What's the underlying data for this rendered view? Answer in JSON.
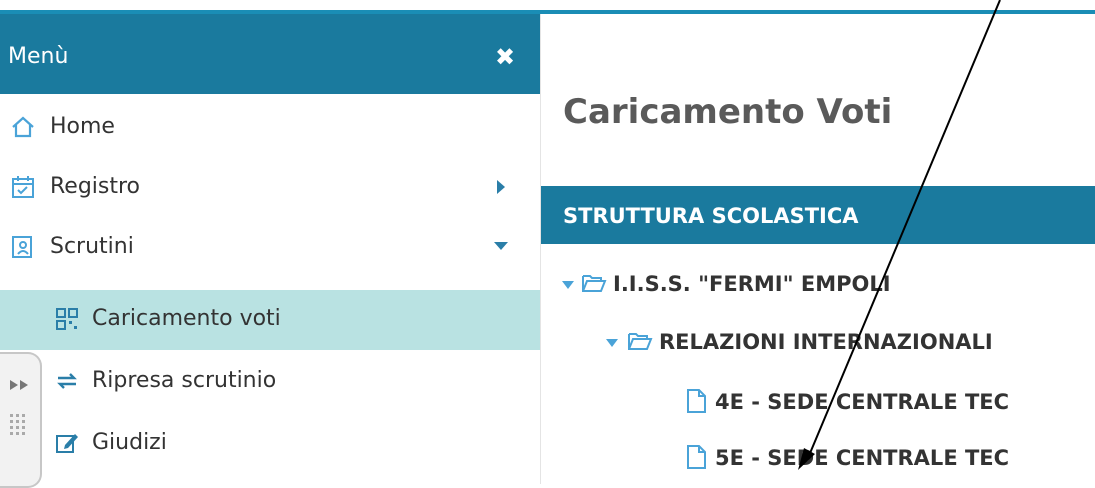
{
  "sidebar": {
    "title": "Menù",
    "items": [
      {
        "label": "Home",
        "icon": "home-icon"
      },
      {
        "label": "Registro",
        "icon": "calendar-icon"
      },
      {
        "label": "Scrutini",
        "icon": "scrutini-icon"
      },
      {
        "label": "Caricamento voti",
        "icon": "qr-grid-icon",
        "active": true
      },
      {
        "label": "Ripresa scrutinio",
        "icon": "refresh-icon"
      },
      {
        "label": "Giudizi",
        "icon": "edit-icon"
      }
    ]
  },
  "main": {
    "page_title": "Caricamento Voti",
    "section_title": "STRUTTURA SCOLASTICA",
    "tree": [
      {
        "label": "I.I.S.S. \"FERMI\" EMPOLI",
        "type": "folder"
      },
      {
        "label": "RELAZIONI INTERNAZIONALI",
        "type": "folder"
      },
      {
        "label": "4E - SEDE CENTRALE TEC",
        "type": "file"
      },
      {
        "label": "5E - SEDE CENTRALE TEC",
        "type": "file"
      }
    ]
  },
  "colors": {
    "header": "#1a7a9e",
    "active_item": "#b9e2e2",
    "accent": "#1a8db5",
    "icon_blue": "#4aa3d8"
  }
}
